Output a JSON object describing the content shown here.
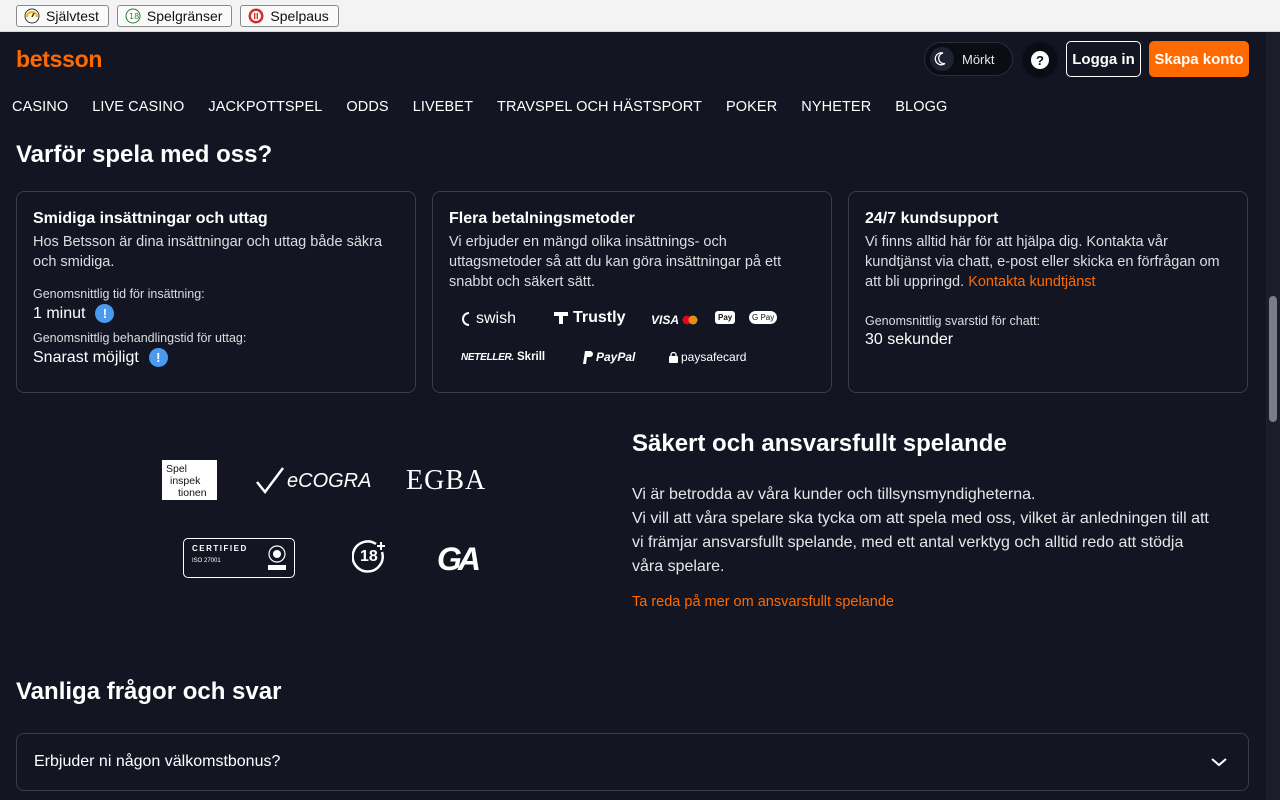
{
  "rg_bar": {
    "self_test": "Självtest",
    "limits": "Spelgränser",
    "pause": "Spelpaus"
  },
  "header": {
    "logo": "betsson",
    "dark_mode_label": "Mörkt",
    "help_symbol": "?",
    "login_label": "Logga in",
    "signup_label": "Skapa konto"
  },
  "nav": [
    "CASINO",
    "LIVE CASINO",
    "JACKPOTTSPEL",
    "ODDS",
    "LIVEBET",
    "TRAVSPEL OCH HÄSTSPORT",
    "POKER",
    "NYHETER",
    "BLOGG"
  ],
  "why": {
    "title": "Varför spela med oss?",
    "cards": [
      {
        "title": "Smidiga insättningar och uttag",
        "text": "Hos Betsson är dina insättningar och uttag både säkra och smidiga.",
        "stat1_label": "Genomsnittlig tid för insättning:",
        "stat1_value": "1 minut",
        "stat2_label": "Genomsnittlig behandlingstid för uttag:",
        "stat2_value": "Snarast möjligt"
      },
      {
        "title": "Flera betalningsmetoder",
        "text": "Vi erbjuder en mängd olika insättnings- och uttagsmetoder så att du kan göra insättningar på ett snabbt och säkert sätt.",
        "methods": [
          "swish",
          "Trustly",
          "VISA",
          "Pay",
          "G Pay",
          "NETELLER.",
          "Skrill",
          "PayPal",
          "paysafecard"
        ]
      },
      {
        "title": "24/7 kundsupport",
        "text": "Vi finns alltid här för att hjälpa dig. Kontakta vår kundtjänst via chatt, e-post eller skicka en förfrågan om att bli uppringd.",
        "link": "Kontakta kundtjänst",
        "stat_label": "Genomsnittlig svarstid för chatt:",
        "stat_value": "30 sekunder"
      }
    ]
  },
  "badges": {
    "spelinspektionen": [
      "Spel",
      "inspek",
      "tionen"
    ],
    "ecogra": "eCOGRA",
    "egba": "EGBA",
    "certified": "CERTIFIED",
    "iso": "ISO 27001",
    "age": "18",
    "ga": "GA"
  },
  "responsible": {
    "title": "Säkert och ansvarsfullt spelande",
    "line1": "Vi är betrodda av våra kunder och tillsynsmyndigheterna.",
    "line2": "Vi vill att våra spelare ska tycka om att spela med oss, vilket är anledningen till att vi främjar ansvarsfullt spelande, med ett antal verktyg och alltid redo att stödja våra spelare.",
    "link": "Ta reda på mer om ansvarsfullt spelande"
  },
  "faq": {
    "title": "Vanliga frågor och svar",
    "items": [
      "Erbjuder ni någon välkomstbonus?"
    ]
  },
  "colors": {
    "accent": "#ff6a00",
    "bg": "#131622",
    "info": "#4a9bf0"
  }
}
